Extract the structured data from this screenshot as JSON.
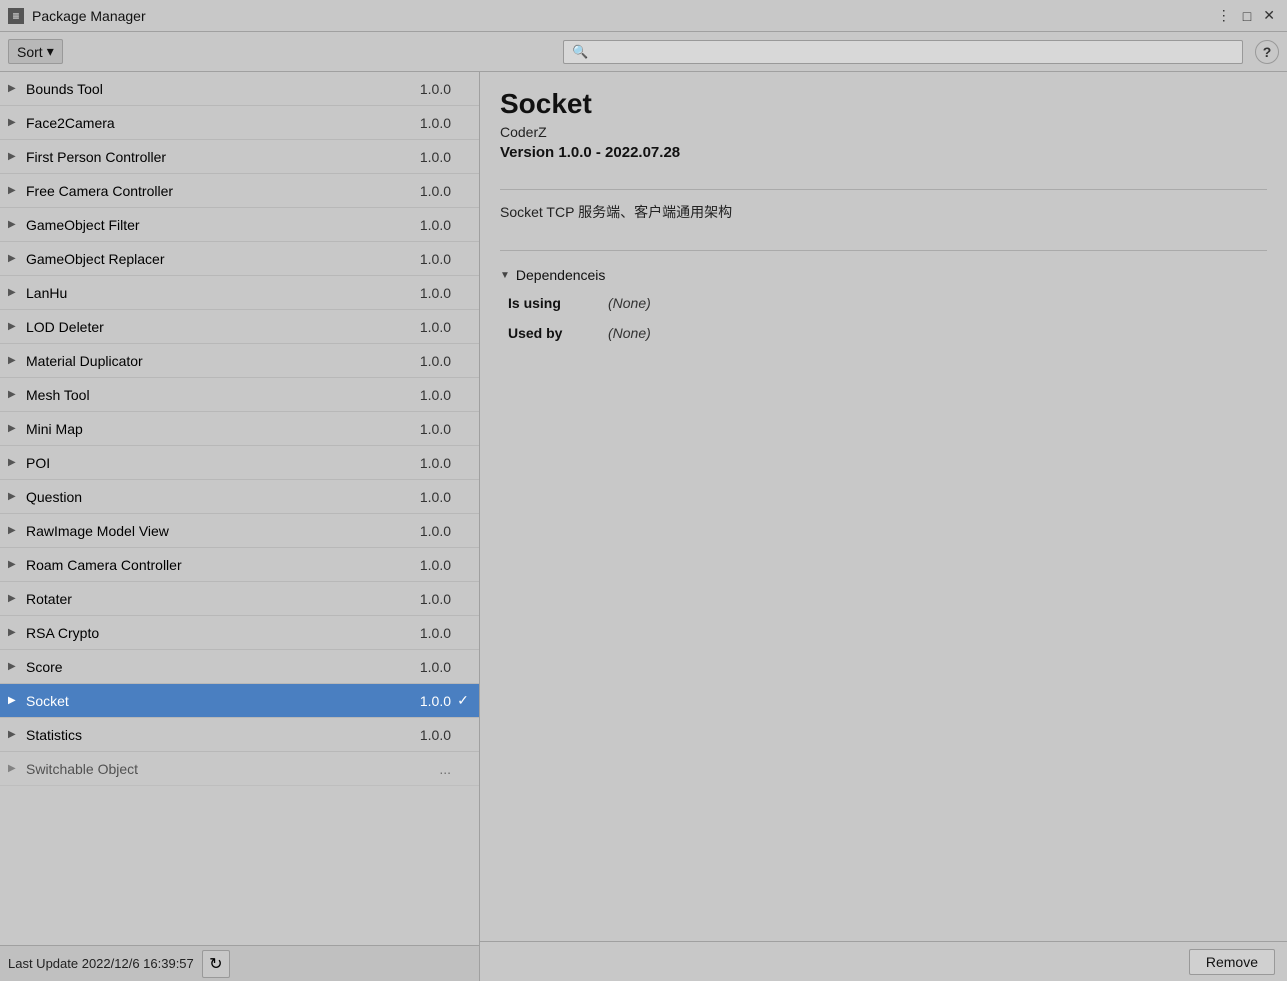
{
  "titleBar": {
    "title": "Package Manager",
    "iconText": "≡",
    "moreIcon": "⋮",
    "maximizeIcon": "□",
    "closeIcon": "✕"
  },
  "toolbar": {
    "sortLabel": "Sort",
    "sortDropdownIcon": "▾",
    "searchPlaceholder": "🔍",
    "helpLabel": "?"
  },
  "packageList": {
    "items": [
      {
        "name": "Bounds Tool",
        "version": "1.0.0",
        "selected": false,
        "check": ""
      },
      {
        "name": "Face2Camera",
        "version": "1.0.0",
        "selected": false,
        "check": ""
      },
      {
        "name": "First Person Controller",
        "version": "1.0.0",
        "selected": false,
        "check": ""
      },
      {
        "name": "Free Camera Controller",
        "version": "1.0.0",
        "selected": false,
        "check": ""
      },
      {
        "name": "GameObject Filter",
        "version": "1.0.0",
        "selected": false,
        "check": ""
      },
      {
        "name": "GameObject Replacer",
        "version": "1.0.0",
        "selected": false,
        "check": ""
      },
      {
        "name": "LanHu",
        "version": "1.0.0",
        "selected": false,
        "check": ""
      },
      {
        "name": "LOD Deleter",
        "version": "1.0.0",
        "selected": false,
        "check": ""
      },
      {
        "name": "Material Duplicator",
        "version": "1.0.0",
        "selected": false,
        "check": ""
      },
      {
        "name": "Mesh Tool",
        "version": "1.0.0",
        "selected": false,
        "check": ""
      },
      {
        "name": "Mini Map",
        "version": "1.0.0",
        "selected": false,
        "check": ""
      },
      {
        "name": "POI",
        "version": "1.0.0",
        "selected": false,
        "check": ""
      },
      {
        "name": "Question",
        "version": "1.0.0",
        "selected": false,
        "check": ""
      },
      {
        "name": "RawImage Model View",
        "version": "1.0.0",
        "selected": false,
        "check": ""
      },
      {
        "name": "Roam Camera Controller",
        "version": "1.0.0",
        "selected": false,
        "check": ""
      },
      {
        "name": "Rotater",
        "version": "1.0.0",
        "selected": false,
        "check": ""
      },
      {
        "name": "RSA Crypto",
        "version": "1.0.0",
        "selected": false,
        "check": ""
      },
      {
        "name": "Score",
        "version": "1.0.0",
        "selected": false,
        "check": ""
      },
      {
        "name": "Socket",
        "version": "1.0.0",
        "selected": true,
        "check": "✓"
      },
      {
        "name": "Statistics",
        "version": "1.0.0",
        "selected": false,
        "check": ""
      },
      {
        "name": "Switchable Object",
        "version": "...",
        "selected": false,
        "check": ""
      }
    ]
  },
  "statusBar": {
    "lastUpdate": "Last Update 2022/12/6 16:39:57",
    "refreshIcon": "↻"
  },
  "detail": {
    "title": "Socket",
    "author": "CoderZ",
    "versionLine": "Version 1.0.0 - 2022.07.28",
    "description": "Socket TCP 服务端、客户端通用架构",
    "dependenciesLabel": "Dependenceis",
    "dependenciesArrow": "▼",
    "isUsingLabel": "Is using",
    "isUsingValue": "(None)",
    "usedByLabel": "Used by",
    "usedByValue": "(None)"
  },
  "bottomBar": {
    "removeLabel": "Remove"
  }
}
